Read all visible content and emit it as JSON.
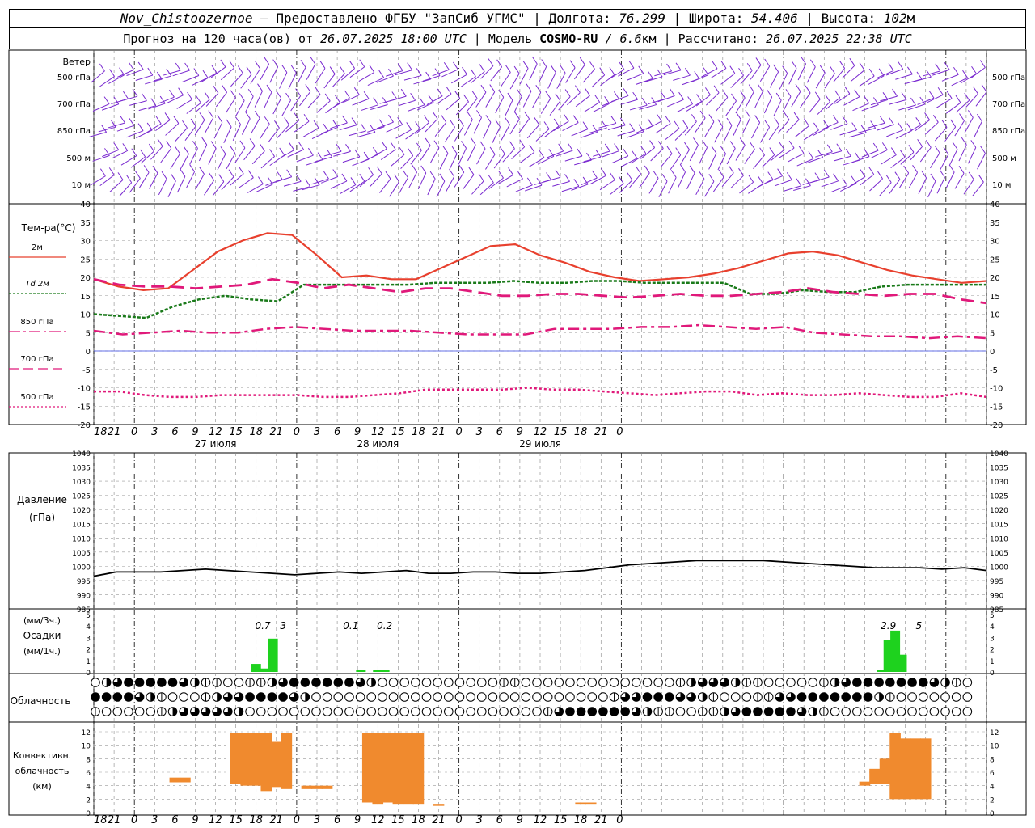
{
  "header": {
    "station": "Nov_Chistoozernoe",
    "provider": " – Предоставлено ФГБУ \"ЗапСиб УГМС\" | Долгота: ",
    "lon": "76.299",
    "lat_label": " | Широта: ",
    "lat": "54.406",
    "alt_label": " | Высота: ",
    "alt": "102",
    "alt_unit": "м",
    "line2_prefix": "Прогноз на 120 часа(ов) от ",
    "init_time": "26.07.2025 18:00 UTC",
    "model_label": " | Модель ",
    "model": "COSMO-RU",
    "res_sep": " / ",
    "res": "6.6",
    "res_unit": "км | Рассчитано: ",
    "calc_time": "26.07.2025 22:38 UTC"
  },
  "panels": {
    "wind": {
      "title": "Ветер",
      "levels": [
        "500 гПа",
        "700 гПа",
        "850 гПа",
        "500 м",
        "10  м"
      ]
    },
    "temp": {
      "title": "Тем-ра(°C)",
      "legend": [
        "2м",
        "Td  2м",
        "850 гПа",
        "700 гПа",
        "500 гПа"
      ],
      "colors": {
        "t2m": "#e8402e",
        "td2m": "#1a7a1a",
        "t850": "#e0197a",
        "t700": "#e0197a",
        "t500": "#e0197a",
        "zero": "#3040e0"
      }
    },
    "pressure": {
      "title1": "Давление",
      "title2": "(гПа)"
    },
    "precip": {
      "title1": "(мм/3ч.)",
      "title2": "Осадки",
      "title3": "(мм/1ч.)",
      "bar_color": "#1ed21e"
    },
    "clouds": {
      "title": "Облачность"
    },
    "convective": {
      "title1": "Конвективн.",
      "title2": "облачность",
      "title3": "(км)",
      "bar_color": "#f08a2e"
    }
  },
  "axis": {
    "hour_labels": [
      "18",
      "21",
      "0",
      "3",
      "6",
      "9",
      "12",
      "15",
      "18",
      "21",
      "0",
      "3",
      "6",
      "9",
      "12",
      "15",
      "18",
      "21",
      "0",
      "3",
      "6",
      "9",
      "12",
      "15",
      "18",
      "21",
      "0"
    ],
    "day_labels": [
      "27 июля",
      "28 июля",
      "29 июля"
    ]
  },
  "chart_data": [
    {
      "type": "line",
      "title": "Тем-ра(°C)",
      "ylim": [
        -20,
        40
      ],
      "x_hours": [
        0,
        3,
        6,
        9,
        12,
        15,
        18,
        21,
        24,
        27,
        30,
        33,
        36,
        39,
        42,
        45,
        48,
        51,
        54,
        57,
        60,
        63,
        66,
        69,
        72,
        75,
        78,
        81,
        84,
        87,
        90,
        93,
        96,
        99,
        102,
        105,
        108,
        111,
        114,
        117,
        120,
        123,
        126,
        129,
        132
      ],
      "series": [
        {
          "name": "2м",
          "values": [
            19.5,
            17.5,
            16.5,
            17,
            22,
            27,
            30,
            32,
            31.5,
            26,
            20,
            20.5,
            19.5,
            19.5,
            22.5,
            25.5,
            28.5,
            29,
            26,
            24,
            21.5,
            20,
            19,
            19.5,
            20,
            21,
            22.5,
            24.5,
            26.5,
            27,
            26,
            24,
            22,
            20.5,
            19.5,
            18.5,
            19
          ]
        },
        {
          "name": "Td  2м",
          "values": [
            10,
            9.5,
            9,
            12,
            14,
            15,
            14,
            13.5,
            18,
            18,
            18,
            18,
            18,
            18.5,
            18.5,
            18.5,
            19,
            18.5,
            18.5,
            19,
            19,
            18.5,
            18.5,
            18.5,
            18.5,
            15.5,
            15.5,
            16.5,
            16,
            16,
            17.5,
            18,
            18,
            18,
            18
          ]
        },
        {
          "name": "850 гПа",
          "values": [
            5.5,
            4.5,
            5,
            5.5,
            5,
            5,
            6,
            6.5,
            6,
            5.5,
            5.5,
            5.5,
            5,
            4.5,
            4.5,
            4.5,
            6,
            6,
            6,
            6.5,
            6.5,
            7,
            6.5,
            6,
            6.5,
            5,
            4.5,
            4,
            4,
            3.5,
            4,
            3.5
          ]
        },
        {
          "name": "700 гПа",
          "values": [
            19.5,
            18,
            17.5,
            17.5,
            17,
            17.5,
            18,
            19.5,
            18.5,
            17,
            18,
            17,
            16,
            17,
            17,
            16,
            15,
            15,
            15.5,
            15.5,
            15,
            14.5,
            15,
            15.5,
            15,
            15,
            15.5,
            16,
            17,
            16,
            15.5,
            15,
            15.5,
            15.5,
            14,
            13
          ]
        },
        {
          "name": "500 гПа",
          "values": [
            -11,
            -11,
            -12,
            -12.5,
            -12.5,
            -12,
            -12,
            -12,
            -12,
            -12.5,
            -12.5,
            -12,
            -11.5,
            -10.5,
            -10.5,
            -10.5,
            -10.5,
            -10,
            -10.5,
            -10.5,
            -11,
            -11.5,
            -12,
            -11.5,
            -11,
            -11,
            -12,
            -11.5,
            -12,
            -12,
            -11.5,
            -12,
            -12.5,
            -12.5,
            -11.5,
            -12.5
          ]
        }
      ]
    },
    {
      "type": "line",
      "title": "Давление (гПа)",
      "ylim": [
        985,
        1040
      ],
      "series": [
        {
          "name": "Давление",
          "values": [
            996.5,
            998,
            998,
            998,
            998.5,
            999,
            998.5,
            998,
            997.5,
            997,
            997.5,
            998,
            997.5,
            998,
            998.5,
            997.5,
            997.5,
            998,
            998,
            997.5,
            997.5,
            998,
            998.5,
            999.5,
            1000.5,
            1001,
            1001.5,
            1002,
            1002,
            1002,
            1002,
            1001.5,
            1001,
            1000.5,
            1000,
            999.5,
            999.5,
            999.5,
            999,
            999.5,
            998.5
          ]
        }
      ]
    },
    {
      "type": "bar",
      "title": "Осадки",
      "ylim": [
        0,
        5
      ],
      "labels": [
        "0.7",
        "3",
        "0.1",
        "0.2",
        "2.9",
        "5"
      ],
      "bars": [
        {
          "hour": 24,
          "value": 0.7
        },
        {
          "hour": 25.3,
          "value": 0.3
        },
        {
          "hour": 26.5,
          "value": 2.9
        },
        {
          "hour": 39.5,
          "value": 0.2
        },
        {
          "hour": 42,
          "value": 0.15
        },
        {
          "hour": 43,
          "value": 0.2
        },
        {
          "hour": 116.5,
          "value": 0.2
        },
        {
          "hour": 117.5,
          "value": 2.8
        },
        {
          "hour": 118.5,
          "value": 3.6
        },
        {
          "hour": 119.5,
          "value": 1.5
        }
      ]
    },
    {
      "type": "bar",
      "title": "Конвективн. облачность (км)",
      "ylim": [
        0,
        12
      ],
      "bars": [
        {
          "hour": 12,
          "low": 4.5,
          "high": 5.2
        },
        {
          "hour": 13.5,
          "low": 4.5,
          "high": 5.2
        },
        {
          "hour": 21,
          "low": 4.2,
          "high": 11.8
        },
        {
          "hour": 22.5,
          "low": 4,
          "high": 11.8
        },
        {
          "hour": 24,
          "low": 4,
          "high": 11.8
        },
        {
          "hour": 25.5,
          "low": 3.2,
          "high": 11.8
        },
        {
          "hour": 27,
          "low": 3.8,
          "high": 10.5
        },
        {
          "hour": 28.5,
          "low": 3.5,
          "high": 11.8
        },
        {
          "hour": 31.5,
          "low": 3.5,
          "high": 4
        },
        {
          "hour": 33,
          "low": 3.5,
          "high": 4
        },
        {
          "hour": 34.5,
          "low": 3.5,
          "high": 4
        },
        {
          "hour": 40.5,
          "low": 1.5,
          "high": 11.8
        },
        {
          "hour": 42,
          "low": 1.3,
          "high": 11.8
        },
        {
          "hour": 43.5,
          "low": 1.5,
          "high": 11.8
        },
        {
          "hour": 45,
          "low": 1.3,
          "high": 11.8
        },
        {
          "hour": 46.5,
          "low": 1.3,
          "high": 11.8
        },
        {
          "hour": 48,
          "low": 1.3,
          "high": 11.8
        },
        {
          "hour": 51,
          "low": 1,
          "high": 1.3
        },
        {
          "hour": 72,
          "low": 1.3,
          "high": 1.5
        },
        {
          "hour": 73.5,
          "low": 1.3,
          "high": 1.5
        },
        {
          "hour": 114,
          "low": 4,
          "high": 4.6
        },
        {
          "hour": 115.5,
          "low": 4.3,
          "high": 6.5
        },
        {
          "hour": 117,
          "low": 4.3,
          "high": 8
        },
        {
          "hour": 118.5,
          "low": 2,
          "high": 11.8
        },
        {
          "hour": 120,
          "low": 2,
          "high": 11
        },
        {
          "hour": 121.5,
          "low": 2,
          "high": 11
        },
        {
          "hour": 123,
          "low": 2,
          "high": 11
        }
      ]
    }
  ]
}
